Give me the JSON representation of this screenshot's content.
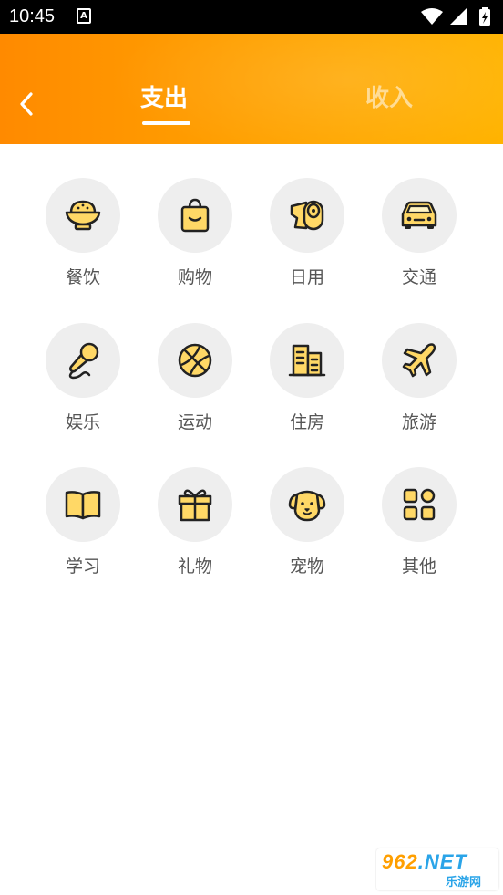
{
  "status_bar": {
    "time": "10:45",
    "notification_glyph": "A"
  },
  "header": {
    "back_icon": "chevron-left-icon",
    "tabs": [
      {
        "label": "支出",
        "active": true
      },
      {
        "label": "收入",
        "active": false
      }
    ],
    "gradient": [
      "#ff8a00",
      "#ffb300"
    ]
  },
  "categories": [
    {
      "label": "餐饮",
      "icon": "rice-bowl-icon"
    },
    {
      "label": "购物",
      "icon": "shopping-bag-icon"
    },
    {
      "label": "日用",
      "icon": "toilet-paper-icon"
    },
    {
      "label": "交通",
      "icon": "car-icon"
    },
    {
      "label": "娱乐",
      "icon": "microphone-icon"
    },
    {
      "label": "运动",
      "icon": "basketball-icon"
    },
    {
      "label": "住房",
      "icon": "building-icon"
    },
    {
      "label": "旅游",
      "icon": "airplane-icon"
    },
    {
      "label": "学习",
      "icon": "book-icon"
    },
    {
      "label": "礼物",
      "icon": "gift-icon"
    },
    {
      "label": "宠物",
      "icon": "dog-icon"
    },
    {
      "label": "其他",
      "icon": "apps-grid-icon"
    }
  ],
  "icon_colors": {
    "fill": "#ffd866",
    "stroke": "#222222",
    "circle": "#eeeeee"
  },
  "watermark": {
    "top": "962",
    "net": ".NET",
    "bottom": "乐游网"
  }
}
